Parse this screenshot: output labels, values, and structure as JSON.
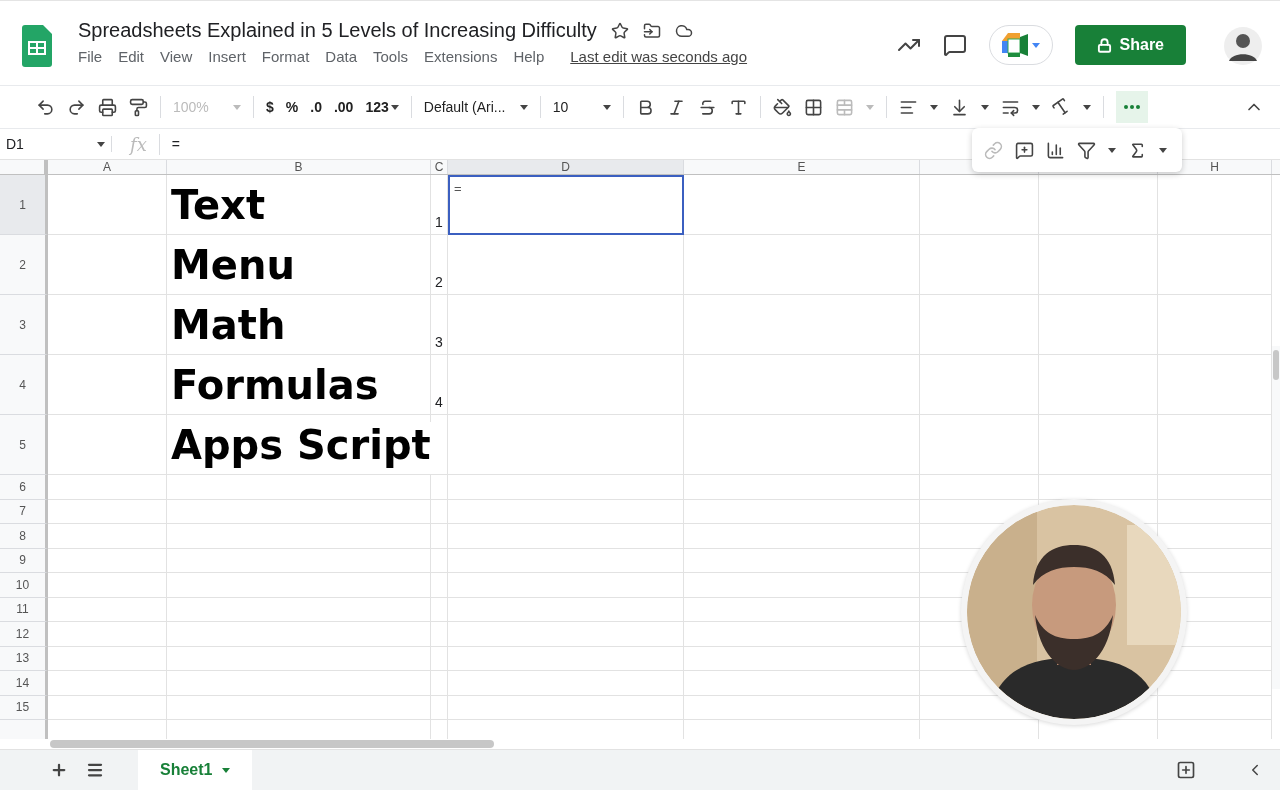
{
  "document": {
    "title": "Spreadsheets Explained in 5 Levels of Increasing Difficulty",
    "last_edit": "Last edit was seconds ago"
  },
  "menu": [
    "File",
    "Edit",
    "View",
    "Insert",
    "Format",
    "Data",
    "Tools",
    "Extensions",
    "Help"
  ],
  "share_button": "Share",
  "toolbar": {
    "zoom": "100%",
    "currency": "$",
    "percent": "%",
    "decrease_decimals": ".0",
    "increase_decimals": ".00",
    "number_format": "123",
    "font": "Default (Ari...",
    "font_size": "10",
    "more_open": true
  },
  "formula_bar": {
    "cell_ref": "D1",
    "fx": "fx",
    "value": "="
  },
  "columns": [
    {
      "label": "A",
      "selected": false
    },
    {
      "label": "B",
      "selected": false
    },
    {
      "label": "C",
      "selected": false
    },
    {
      "label": "D",
      "selected": true
    },
    {
      "label": "E",
      "selected": false
    },
    {
      "selected": false
    },
    {
      "selected": false
    },
    {
      "label": "H",
      "selected": false
    }
  ],
  "rows": [
    {
      "label": "1",
      "selected": true,
      "b": "Text",
      "c": "1",
      "d": "=",
      "d_selected": true
    },
    {
      "label": "2",
      "selected": false,
      "b": "Menu",
      "c": "2",
      "d_selected": false
    },
    {
      "label": "3",
      "selected": false,
      "b": "Math",
      "c": "3",
      "d_selected": false
    },
    {
      "label": "4",
      "selected": false,
      "b": "Formulas",
      "c": "4",
      "d_selected": false
    },
    {
      "label": "5",
      "selected": false,
      "b": "Apps Script",
      "d_selected": false
    },
    {
      "label": "6",
      "selected": false,
      "d_selected": false
    },
    {
      "label": "7",
      "selected": false,
      "d_selected": false
    },
    {
      "label": "8",
      "selected": false,
      "d_selected": false
    },
    {
      "label": "9",
      "selected": false,
      "d_selected": false
    },
    {
      "label": "10",
      "selected": false,
      "d_selected": false
    },
    {
      "label": "11",
      "selected": false,
      "d_selected": false
    },
    {
      "label": "12",
      "selected": false,
      "d_selected": false
    },
    {
      "label": "13",
      "selected": false,
      "d_selected": false
    },
    {
      "label": "14",
      "selected": false,
      "d_selected": false
    },
    {
      "label": "15",
      "selected": false,
      "d_selected": false
    }
  ],
  "sheet_tabs": [
    {
      "label": "Sheet1",
      "selected": true
    }
  ]
}
